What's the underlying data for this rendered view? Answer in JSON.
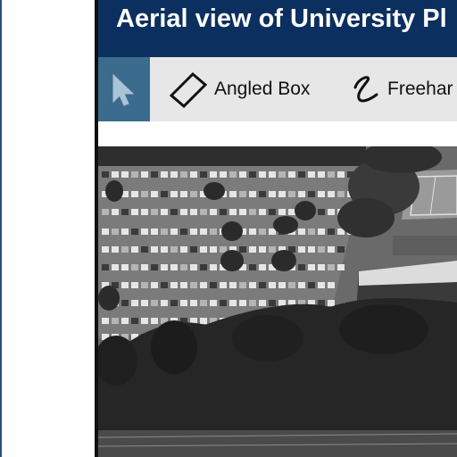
{
  "window": {
    "title": "Aerial view of University Pl"
  },
  "toolbar": {
    "tools": [
      {
        "label": "",
        "icon": "cursor-arrow-icon",
        "selected": true
      },
      {
        "label": "Angled Box",
        "icon": "angled-box-icon",
        "selected": false
      },
      {
        "label": "Freehar",
        "icon": "freehand-squiggle-icon",
        "selected": false
      }
    ]
  },
  "colors": {
    "title_bar": "#0b2f5f",
    "toolbar_bg": "#e7e7e7",
    "selected_tool_bg": "#3b6c8e"
  }
}
